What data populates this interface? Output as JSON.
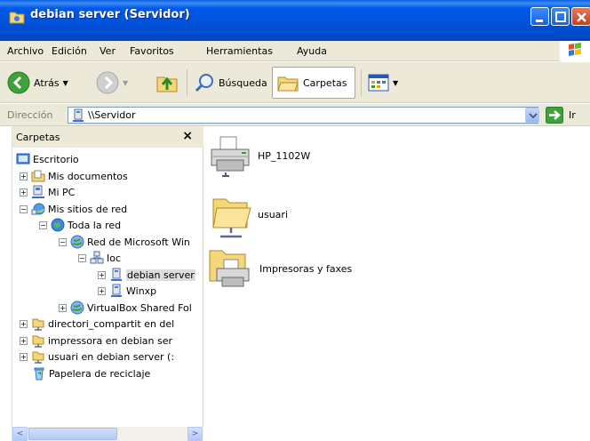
{
  "window": {
    "title": "debian server (Servidor)"
  },
  "menu": [
    "Archivo",
    "Edición",
    "Ver",
    "Favoritos",
    "Herramientas",
    "Ayuda"
  ],
  "toolbar": {
    "back_label": "Atrás",
    "search_label": "Búsqueda",
    "folders_label": "Carpetas"
  },
  "address": {
    "label": "Dirección",
    "value": "\\\\Servidor",
    "go_label": "Ir"
  },
  "folder_pane": {
    "title": "Carpetas",
    "close": "×",
    "items": [
      {
        "label": "Escritorio",
        "expander": ""
      },
      {
        "label": "Mis documentos",
        "expander": "+"
      },
      {
        "label": "Mi PC",
        "expander": "+"
      },
      {
        "label": "Mis sitios de red",
        "expander": "−"
      },
      {
        "label": "Toda la red",
        "expander": "−"
      },
      {
        "label": "Red de Microsoft Win",
        "expander": "−"
      },
      {
        "label": "Ioc",
        "expander": "−"
      },
      {
        "label": "debian server",
        "expander": "+"
      },
      {
        "label": "Winxp",
        "expander": "+"
      },
      {
        "label": "VirtualBox Shared Fol",
        "expander": "+"
      },
      {
        "label": "directori_compartit en del",
        "expander": "+"
      },
      {
        "label": "impressora en debian ser",
        "expander": "+"
      },
      {
        "label": "usuari en debian server (:",
        "expander": "+"
      },
      {
        "label": "Papelera de reciclaje",
        "expander": ""
      }
    ]
  },
  "content": {
    "items": [
      {
        "label": "HP_1102W",
        "icon": "printer-icon"
      },
      {
        "label": "usuari",
        "icon": "shared-folder-icon"
      },
      {
        "label": "Impresoras y faxes",
        "icon": "printers-folder-icon"
      }
    ]
  },
  "scrollbar": {
    "left_arrow": "<",
    "right_arrow": ">"
  }
}
